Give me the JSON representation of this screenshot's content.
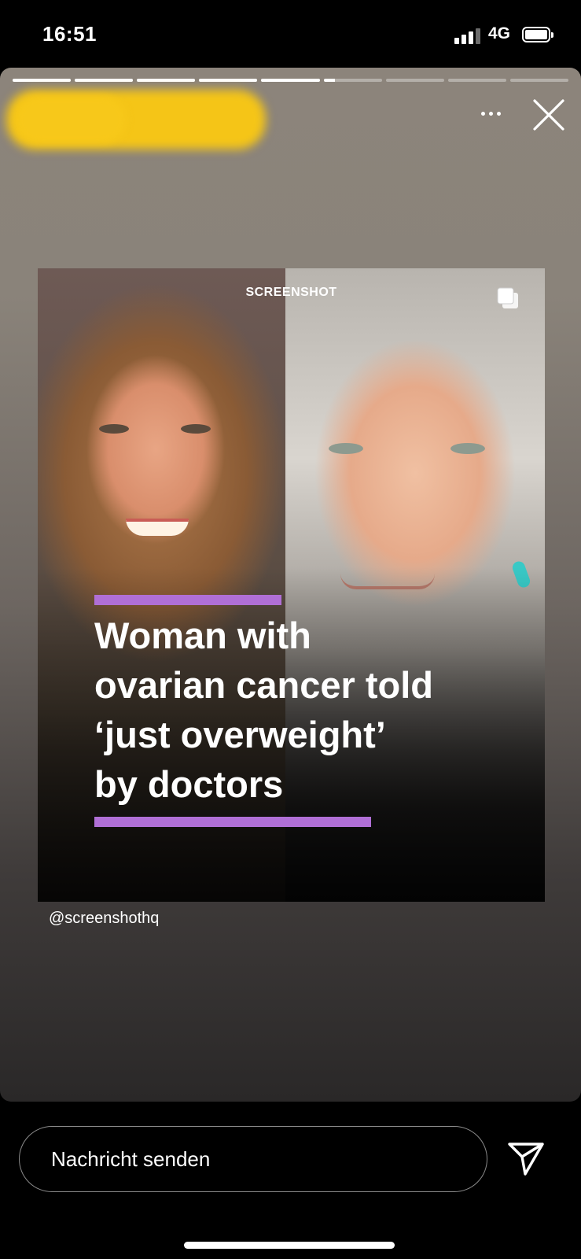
{
  "status_bar": {
    "time": "16:51",
    "network": "4G"
  },
  "story": {
    "progress_segments": [
      1,
      1,
      1,
      1,
      1,
      0.2,
      0,
      0,
      0
    ],
    "username_obscured": true
  },
  "post": {
    "brand": "SCREENSHOT",
    "headline_lines": [
      "Woman with",
      "ovarian cancer told",
      "‘just overweight’",
      "by doctors"
    ],
    "accent_color": "#b06fd6",
    "handle": "@screenshothq"
  },
  "reply": {
    "placeholder": "Nachricht senden"
  },
  "icons": [
    "more-icon",
    "close-icon",
    "multiple-images-icon",
    "send-icon"
  ]
}
